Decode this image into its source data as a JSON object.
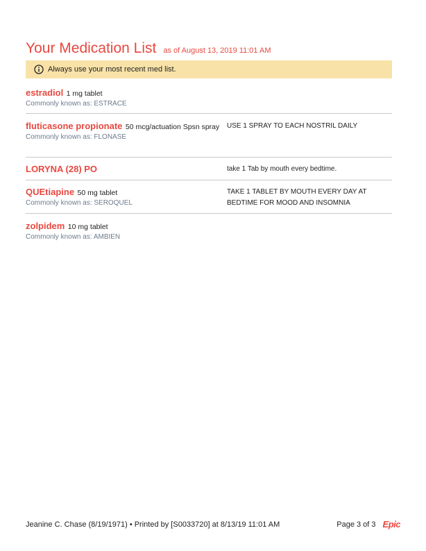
{
  "header": {
    "title": "Your Medication List",
    "as_of": "as of August 13, 2019 11:01 AM"
  },
  "notice": {
    "icon": "info-icon",
    "text": "Always use your most recent med list."
  },
  "medications": [
    {
      "name": "estradiol",
      "dose": "1 mg tablet",
      "known_as": "Commonly known as: ESTRACE",
      "instructions": ""
    },
    {
      "name": "fluticasone propionate",
      "dose": "50 mcg/actuation Spsn spray",
      "known_as": "Commonly known as: FLONASE",
      "instructions": "USE 1 SPRAY TO EACH NOSTRIL DAILY"
    },
    {
      "name": "LORYNA (28) PO",
      "dose": "",
      "known_as": "",
      "instructions": "take 1 Tab by mouth every bedtime."
    },
    {
      "name": "QUEtiapine",
      "dose": "50 mg tablet",
      "known_as": "Commonly known as: SEROQUEL",
      "instructions": "TAKE 1 TABLET BY MOUTH EVERY DAY AT BEDTIME FOR MOOD AND INSOMNIA"
    },
    {
      "name": "zolpidem",
      "dose": "10 mg tablet",
      "known_as": "Commonly known as: AMBIEN",
      "instructions": ""
    }
  ],
  "footer": {
    "patient_info": "Jeanine C. Chase (8/19/1971) • Printed by [S0033720] at 8/13/19 11:01 AM",
    "page": "Page 3 of 3",
    "logo": "Epic"
  }
}
